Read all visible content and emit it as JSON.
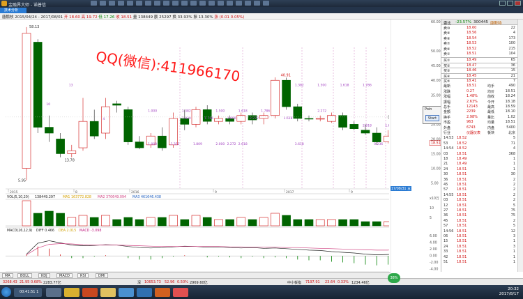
{
  "window": {
    "title": "金融界大师 - 诺普信",
    "tab_label": "技术分析"
  },
  "info_bar": {
    "name": "唐鹏核",
    "date_range": "2015/04/24 - 2017/08/01",
    "open": "开 18.60",
    "high": "高 19.72",
    "low": "低 17.26",
    "close": "收 18.51",
    "volume": "量 138449",
    "amount": "额 25297",
    "turnover": "换 33.93%",
    "amplitude": "振 13.30%",
    "change": "涨 (0.01 0.05%)"
  },
  "watermark": "QQ(微信):411966170",
  "chart_data": {
    "type": "candlestick",
    "price_axis": {
      "ticks": [
        "60.00",
        "50.00",
        "45.00",
        "40.00",
        "35.00",
        "30.00",
        "25.00",
        "20.00",
        "15.00",
        "10.00",
        "5.00"
      ]
    },
    "date_labels": [
      "2015",
      "8",
      "2016",
      "9",
      "2017",
      "9"
    ],
    "max_label": "58.13",
    "min_label": "5.95",
    "low_label": "13.78",
    "peak_label": "40.91",
    "current_tag": "17/08/31 五",
    "candles": [
      {
        "o": 10.0,
        "h": 58.13,
        "l": 5.95,
        "c": 56.0
      },
      {
        "o": 53.0,
        "h": 54.0,
        "l": 22.0,
        "c": 24.0
      },
      {
        "o": 24.0,
        "h": 28.0,
        "l": 19.0,
        "c": 22.0
      },
      {
        "o": 20.0,
        "h": 22.0,
        "l": 13.78,
        "c": 15.0
      },
      {
        "o": 15.0,
        "h": 18.0,
        "l": 13.78,
        "c": 16.0
      },
      {
        "o": 17.0,
        "h": 34.0,
        "l": 16.0,
        "c": 26.0
      },
      {
        "o": 26.0,
        "h": 30.0,
        "l": 20.0,
        "c": 21.0
      },
      {
        "o": 22.0,
        "h": 34.0,
        "l": 20.0,
        "c": 31.0
      },
      {
        "o": 32.0,
        "h": 33.0,
        "l": 29.0,
        "c": 31.5
      },
      {
        "o": 30.0,
        "h": 31.0,
        "l": 18.0,
        "c": 19.0
      },
      {
        "o": 19.0,
        "h": 21.0,
        "l": 16.5,
        "c": 17.0
      },
      {
        "o": 18.0,
        "h": 22.0,
        "l": 17.0,
        "c": 21.0
      },
      {
        "o": 21.0,
        "h": 24.0,
        "l": 16.0,
        "c": 17.0
      },
      {
        "o": 18.0,
        "h": 29.0,
        "l": 17.0,
        "c": 27.0
      },
      {
        "o": 27.0,
        "h": 30.0,
        "l": 23.0,
        "c": 25.0
      },
      {
        "o": 25.0,
        "h": 31.0,
        "l": 24.0,
        "c": 30.0
      },
      {
        "o": 30.0,
        "h": 31.5,
        "l": 25.0,
        "c": 26.0
      },
      {
        "o": 26.0,
        "h": 28.0,
        "l": 25.0,
        "c": 27.0
      },
      {
        "o": 27.0,
        "h": 28.0,
        "l": 25.0,
        "c": 26.0
      },
      {
        "o": 26.0,
        "h": 29.0,
        "l": 25.0,
        "c": 28.0
      },
      {
        "o": 28.0,
        "h": 29.0,
        "l": 25.0,
        "c": 26.5
      },
      {
        "o": 27.0,
        "h": 29.0,
        "l": 25.0,
        "c": 28.0
      },
      {
        "o": 28.0,
        "h": 41.0,
        "l": 27.0,
        "c": 40.0
      },
      {
        "o": 40.0,
        "h": 40.91,
        "l": 30.0,
        "c": 31.0
      },
      {
        "o": 31.0,
        "h": 32.0,
        "l": 26.0,
        "c": 27.0
      },
      {
        "o": 27.0,
        "h": 28.0,
        "l": 26.0,
        "c": 26.8
      },
      {
        "o": 27.0,
        "h": 28.0,
        "l": 26.0,
        "c": 27.0
      },
      {
        "o": 26.0,
        "h": 29.0,
        "l": 25.5,
        "c": 28.0
      },
      {
        "o": 28.0,
        "h": 29.0,
        "l": 23.0,
        "c": 24.0
      },
      {
        "o": 25.0,
        "h": 26.0,
        "l": 23.0,
        "c": 23.5
      },
      {
        "o": 23.0,
        "h": 25.0,
        "l": 21.5,
        "c": 22.0
      },
      {
        "o": 22.0,
        "h": 24.0,
        "l": 18.0,
        "c": 19.0
      },
      {
        "o": 19.0,
        "h": 23.0,
        "l": 18.5,
        "c": 21.0
      },
      {
        "o": 21.0,
        "h": 22.0,
        "l": 17.5,
        "c": 18.5
      }
    ],
    "vol_label": "VOL(5,10,20)",
    "vol_values": "138449.297",
    "vol_ma1": "MA1 163772.828",
    "vol_ma2": "MA2 370649.094",
    "vol_ma3": "MA3 461646.438",
    "vol_axis": [
      "x10万",
      "10",
      "5"
    ],
    "volumes": [
      12,
      6,
      7,
      6,
      4,
      5,
      4,
      5,
      3,
      4,
      3,
      4,
      4,
      5,
      3,
      5,
      4,
      3,
      3,
      4,
      3,
      4,
      6,
      5,
      3,
      3,
      3,
      3,
      3,
      3,
      2,
      2,
      2,
      2
    ],
    "macd_label": "MACD(26,12,9)",
    "macd_diff": "DIFF 0.466",
    "macd_dea": "DEA 2.015",
    "macd_macd": "MACD -3.098",
    "macd_axis": [
      "6.00",
      "4.00",
      "2.00",
      "0.00",
      "-2.00",
      "-4.00"
    ],
    "diff_series": [
      0.5,
      3.5,
      4.2,
      3.6,
      3.0,
      2.8,
      2.9,
      3.1,
      3.0,
      2.6,
      2.3,
      2.2,
      2.3,
      2.5,
      2.7,
      2.6,
      2.4,
      2.5,
      2.3,
      2.2,
      2.3,
      2.1,
      2.2,
      2.0,
      1.8,
      1.6,
      1.5,
      1.2,
      1.0,
      0.8,
      0.5,
      0.3,
      0.4,
      0.466
    ],
    "dea_series": [
      0.3,
      2.2,
      3.2,
      3.4,
      3.3,
      3.1,
      3.0,
      3.0,
      3.0,
      2.9,
      2.8,
      2.7,
      2.6,
      2.6,
      2.6,
      2.6,
      2.6,
      2.6,
      2.5,
      2.5,
      2.4,
      2.4,
      2.4,
      2.3,
      2.3,
      2.2,
      2.1,
      2.0,
      1.9,
      1.8,
      1.7,
      1.6,
      1.6,
      2.015
    ],
    "cost_labels": [
      {
        "x": 2,
        "y": 31.5,
        "t": "10"
      },
      {
        "x": 7,
        "y": 26.5,
        "t": "4"
      },
      {
        "x": 11,
        "y": 29.2,
        "t": "1.000"
      },
      {
        "x": 11,
        "y": 18.0,
        "t": "1.000"
      },
      {
        "x": 13,
        "y": 18.0,
        "t": "1.352"
      },
      {
        "x": 14,
        "y": 29.2,
        "t": "1.382"
      },
      {
        "x": 14,
        "y": 26.8,
        "t": "1.830"
      },
      {
        "x": 15,
        "y": 18.0,
        "t": "1.809"
      },
      {
        "x": 16,
        "y": 26.8,
        "t": "1.786"
      },
      {
        "x": 17,
        "y": 18.0,
        "t": "2.000"
      },
      {
        "x": 17,
        "y": 29.2,
        "t": "1.500"
      },
      {
        "x": 18,
        "y": 18.0,
        "t": "2.272"
      },
      {
        "x": 18,
        "y": 26.8,
        "t": "2.000"
      },
      {
        "x": 19,
        "y": 29.2,
        "t": "1.618"
      },
      {
        "x": 19,
        "y": 18.0,
        "t": "2.618"
      },
      {
        "x": 20,
        "y": 26.8,
        "t": "2.272"
      },
      {
        "x": 21,
        "y": 29.2,
        "t": "1.786"
      },
      {
        "x": 23,
        "y": 26.8,
        "t": "1.618"
      },
      {
        "x": 24,
        "y": 18.0,
        "t": "3.618"
      },
      {
        "x": 26,
        "y": 29.2,
        "t": "2.272"
      },
      {
        "x": 24,
        "y": 38.0,
        "t": "1.382"
      },
      {
        "x": 26,
        "y": 38.0,
        "t": "1.500"
      },
      {
        "x": 28,
        "y": 38.0,
        "t": "1.618"
      },
      {
        "x": 30,
        "y": 38.0,
        "t": "1.786"
      },
      {
        "x": 30,
        "y": 24.2,
        "t": "2.618"
      },
      {
        "x": 31,
        "y": 18.0,
        "t": "0.236"
      },
      {
        "x": 32,
        "y": 24.2,
        "t": "1.618"
      },
      {
        "x": 33,
        "y": 38.0,
        "t": "2.618"
      },
      {
        "x": 33,
        "y": 24.2,
        "t": "1.786"
      },
      {
        "x": 35,
        "y": 38.0,
        "t": "2.786"
      },
      {
        "x": 4,
        "y": 38.0,
        "t": "13"
      }
    ]
  },
  "right_axis_tag": "18.51",
  "popup": {
    "title": "Poin",
    "button": "Start"
  },
  "quote_panel": {
    "code": "300445",
    "name": "康斯特",
    "header_label": "委比",
    "header_value": "-23.57%",
    "header_diff": "委差",
    "header_num": "-5",
    "sells": [
      {
        "l": "卖⑩",
        "p": "18.60",
        "v": "22"
      },
      {
        "l": "卖⑨",
        "p": "18.56",
        "v": "4"
      },
      {
        "l": "卖⑧",
        "p": "18.54",
        "v": "173"
      },
      {
        "l": "卖⑦",
        "p": "18.53",
        "v": "100"
      },
      {
        "l": "卖⑥",
        "p": "18.52",
        "v": "215"
      },
      {
        "l": "卖①",
        "p": "18.51",
        "v": "104"
      }
    ],
    "buys": [
      {
        "l": "买①",
        "p": "18.49",
        "v": "65"
      },
      {
        "l": "买②",
        "p": "18.47",
        "v": "36"
      },
      {
        "l": "买③",
        "p": "18.46",
        "v": "15"
      },
      {
        "l": "买④",
        "p": "18.45",
        "v": "21"
      },
      {
        "l": "买⑤",
        "p": "18.41",
        "v": "7"
      }
    ],
    "stats": [
      {
        "l": "最新",
        "p": "18.51",
        "l2": "均手",
        "v": "490"
      },
      {
        "l": "涨跌",
        "p": "0.27",
        "l2": "均价",
        "v": "18.51"
      },
      {
        "l": "涨幅",
        "p": "1.48%",
        "l2": "前收",
        "v": "18.24"
      },
      {
        "l": "振幅",
        "p": "2.63%",
        "l2": "今开",
        "v": "18.18"
      },
      {
        "l": "总手",
        "p": "12143",
        "l2": "最高",
        "v": "18.59"
      },
      {
        "l": "金额",
        "p": "2239",
        "l2": "最低",
        "v": "18.10"
      },
      {
        "l": "换手",
        "p": "2.98%",
        "l2": "量比",
        "v": "1.02"
      },
      {
        "l": "市盈",
        "p": "963",
        "l2": "均量",
        "v": "18.51"
      },
      {
        "l": "外盘",
        "p": "6743",
        "l2": "内盘",
        "v": "5400"
      },
      {
        "l": "行业",
        "p": "仪器仪表",
        "l2": "板块",
        "v": "北京"
      }
    ],
    "ticks": [
      {
        "t": "14:53",
        "p": "18.52",
        "v": "5"
      },
      {
        "t": "53",
        "p": "18.52",
        "v": "71"
      },
      {
        "t": "14:54",
        "p": "18.52",
        "v": "4"
      },
      {
        "t": "03",
        "p": "18.51",
        "v": "368"
      },
      {
        "t": "18",
        "p": "18.49",
        "v": "1"
      },
      {
        "t": "21",
        "p": "18.49",
        "v": "1"
      },
      {
        "t": "24",
        "p": "18.51",
        "v": "1"
      },
      {
        "t": "30",
        "p": "18.51",
        "v": "30"
      },
      {
        "t": "36",
        "p": "18.51",
        "v": "2"
      },
      {
        "t": "45",
        "p": "18.51",
        "v": "2"
      },
      {
        "t": "57",
        "p": "18.51",
        "v": "2"
      },
      {
        "t": "14:55",
        "p": "18.51",
        "v": "2"
      },
      {
        "t": "03",
        "p": "18.51",
        "v": "2"
      },
      {
        "t": "12",
        "p": "18.51",
        "v": "5"
      },
      {
        "t": "27",
        "p": "18.51",
        "v": "75"
      },
      {
        "t": "36",
        "p": "18.51",
        "v": "75"
      },
      {
        "t": "45",
        "p": "18.51",
        "v": "2"
      },
      {
        "t": "57",
        "p": "18.51",
        "v": "5"
      },
      {
        "t": "14:56",
        "p": "18.51",
        "v": "12"
      },
      {
        "t": "06",
        "p": "18.51",
        "v": "3"
      },
      {
        "t": "15",
        "p": "18.51",
        "v": "1"
      },
      {
        "t": "24",
        "p": "18.51",
        "v": "3"
      },
      {
        "t": "33",
        "p": "18.51",
        "v": "1"
      },
      {
        "t": "42",
        "p": "18.51",
        "v": "1"
      },
      {
        "t": "51",
        "p": "18.51",
        "v": "1"
      },
      {
        "t": "15:00",
        "p": "18.51",
        "v": "490"
      }
    ]
  },
  "bottom_tabs": [
    "MA",
    "BOLL",
    "KDJ",
    "MACD",
    "RSI",
    "DMI"
  ],
  "status": {
    "sh": "3268.43",
    "sh_chg": "21.95",
    "sh_pct": "0.68%",
    "sh_amt": "2283.77亿",
    "sz_label": "深",
    "sz": "10653.73",
    "sz_chg": "52.96",
    "sz_pct": "0.50%",
    "sz_amt": "2969.60亿",
    "zx_label": "中小板指",
    "zx": "7197.91",
    "zx_chg": "23.64",
    "zx_pct": "0.33%",
    "zx_amt": "1234.46亿",
    "pct_badge": "38%"
  },
  "taskbar": {
    "media_time": "00:41:51",
    "media_total": "1",
    "time": "20:32",
    "date": "2017/8/17"
  }
}
